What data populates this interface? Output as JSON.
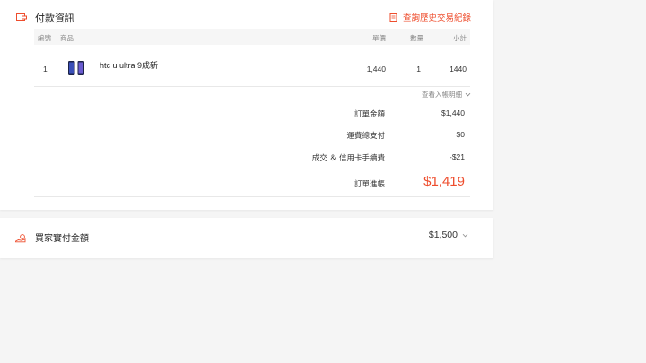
{
  "payment_section": {
    "title": "付款資訊",
    "history_link": "查詢歷史交易紀錄"
  },
  "table": {
    "headers": {
      "no": "編號",
      "item": "商品",
      "price": "單價",
      "qty": "數量",
      "subtotal": "小計"
    },
    "rows": [
      {
        "no": "1",
        "name": "htc u ultra 9成新",
        "price": "1,440",
        "qty": "1",
        "subtotal": "1440"
      }
    ]
  },
  "breakdown_link": "查看入帳明細",
  "summary": [
    {
      "label": "訂單金額",
      "value": "$1,440"
    },
    {
      "label": "運費總支付",
      "value": "$0"
    },
    {
      "label": "成交 ＆ 信用卡手續費",
      "value": "-$21"
    },
    {
      "label": "訂單進帳",
      "value": "$1,419"
    }
  ],
  "buyer_payment": {
    "label": "買家實付金額",
    "value": "$1,500"
  },
  "icons": {
    "section": "wallet-icon",
    "history": "receipt-icon",
    "buyer": "money-hand-icon",
    "chevron": "chevron-down-icon"
  },
  "colors": {
    "accent": "#ee4d2d",
    "muted": "#888888"
  }
}
